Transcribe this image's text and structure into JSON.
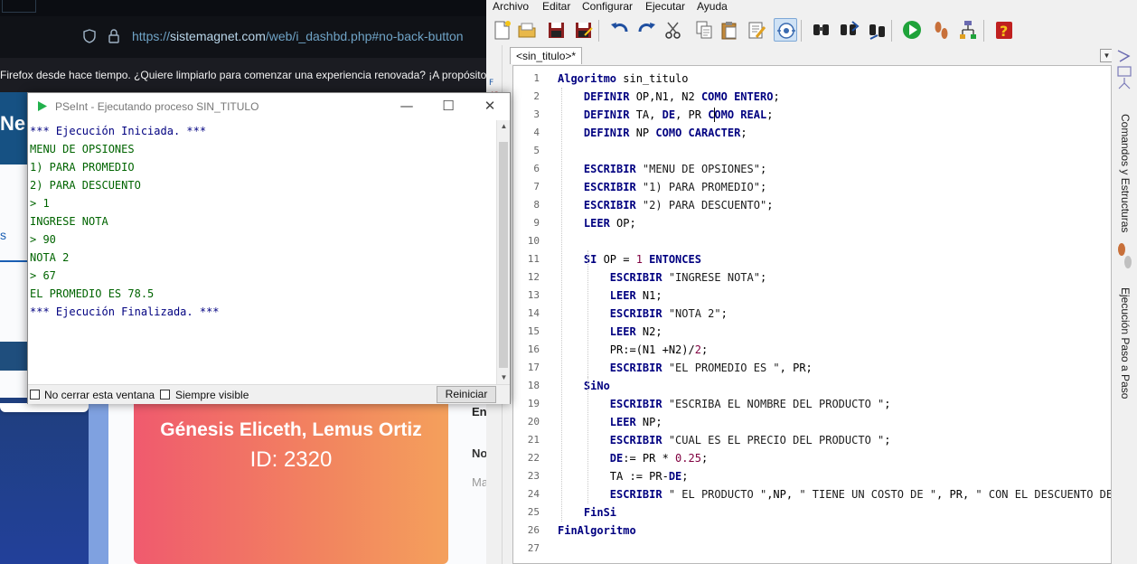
{
  "browser": {
    "url_prefix": "https://",
    "url_domain": "sistemagnet.com",
    "url_path": "/web/i_dashbd.php#no-back-button",
    "notice": "Firefox desde hace tiempo. ¿Quiere limpiarlo para comenzar una experiencia renovada? ¡A propósito, b",
    "page": {
      "heading_partial": "Ne",
      "link_partial": "s",
      "card_name": "Génesis Eliceth, Lemus Ortiz",
      "card_id": "ID: 2320",
      "right_text_1": "En",
      "right_text_2": "No",
      "right_text_3": "Ma"
    }
  },
  "run_window": {
    "title": "PSeInt - Ejecutando proceso SIN_TITULO",
    "controls": {
      "minimize": "—",
      "maximize": "☐",
      "close": "✕"
    },
    "output": [
      {
        "text": "*** Ejecución Iniciada. ***",
        "color": "#000080"
      },
      {
        "text": "MENU DE OPSIONES",
        "color": "#006400"
      },
      {
        "text": "1) PARA PROMEDIO",
        "color": "#006400"
      },
      {
        "text": "2) PARA DESCUENTO",
        "color": "#006400"
      },
      {
        "text": "> 1",
        "color": "#006400"
      },
      {
        "text": "INGRESE NOTA",
        "color": "#006400"
      },
      {
        "text": "> 90",
        "color": "#006400"
      },
      {
        "text": "NOTA 2",
        "color": "#006400"
      },
      {
        "text": "> 67",
        "color": "#006400"
      },
      {
        "text": "EL PROMEDIO ES 78.5",
        "color": "#006400"
      },
      {
        "text": "*** Ejecución Finalizada. ***",
        "color": "#000080"
      }
    ],
    "checkbox_keep_open": "No cerrar esta ventana",
    "checkbox_always_visible": "Siempre visible",
    "restart_button": "Reiniciar"
  },
  "editor": {
    "menu": [
      "Archivo",
      "Editar",
      "Configurar",
      "Ejecutar",
      "Ayuda"
    ],
    "toolbar_icons": [
      "new-file-icon",
      "open-folder-icon",
      "save-icon",
      "save-as-icon",
      "undo-icon",
      "redo-icon",
      "cut-icon",
      "copy-icon",
      "paste-icon",
      "edit-icon",
      "indent-icon",
      "find-icon",
      "find-next-icon",
      "replace-icon",
      "run-icon",
      "step-by-step-icon",
      "flowchart-icon",
      "help-icon"
    ],
    "tab_label": "<sin_titulo>*",
    "right_panel": {
      "commands_label": "Comandos y Estructuras",
      "step_label": "Ejecución Paso a Paso"
    },
    "code_lines": [
      [
        {
          "t": "Algoritmo ",
          "k": "kw"
        },
        {
          "t": "sin_titulo",
          "k": "ident"
        }
      ],
      [
        {
          "t": "    DEFINIR ",
          "k": "kw"
        },
        {
          "t": "OP,N1, N2 ",
          "k": "ident"
        },
        {
          "t": "COMO ENTERO",
          "k": "kw"
        },
        {
          "t": ";",
          "k": "ident"
        }
      ],
      [
        {
          "t": "    DEFINIR ",
          "k": "kw"
        },
        {
          "t": "TA, ",
          "k": "ident"
        },
        {
          "t": "DE",
          "k": "kw"
        },
        {
          "t": ", PR ",
          "k": "ident"
        },
        {
          "t": "COMO REAL",
          "k": "kw"
        },
        {
          "t": ";",
          "k": "ident"
        }
      ],
      [
        {
          "t": "    DEFINIR ",
          "k": "kw"
        },
        {
          "t": "NP ",
          "k": "ident"
        },
        {
          "t": "COMO CARACTER",
          "k": "kw"
        },
        {
          "t": ";",
          "k": "ident"
        }
      ],
      [],
      [
        {
          "t": "    ESCRIBIR ",
          "k": "kw"
        },
        {
          "t": "\"MENU DE OPSIONES\"",
          "k": "str"
        },
        {
          "t": ";",
          "k": "ident"
        }
      ],
      [
        {
          "t": "    ESCRIBIR ",
          "k": "kw"
        },
        {
          "t": "\"1) PARA PROMEDIO\"",
          "k": "str"
        },
        {
          "t": ";",
          "k": "ident"
        }
      ],
      [
        {
          "t": "    ESCRIBIR ",
          "k": "kw"
        },
        {
          "t": "\"2) PARA DESCUENTO\"",
          "k": "str"
        },
        {
          "t": ";",
          "k": "ident"
        }
      ],
      [
        {
          "t": "    LEER ",
          "k": "kw"
        },
        {
          "t": "OP;",
          "k": "ident"
        }
      ],
      [],
      [
        {
          "t": "    SI ",
          "k": "kw"
        },
        {
          "t": "OP = ",
          "k": "ident"
        },
        {
          "t": "1",
          "k": "num-lit"
        },
        {
          "t": " ENTONCES",
          "k": "kw"
        }
      ],
      [
        {
          "t": "        ESCRIBIR ",
          "k": "kw"
        },
        {
          "t": "\"INGRESE NOTA\"",
          "k": "str"
        },
        {
          "t": ";",
          "k": "ident"
        }
      ],
      [
        {
          "t": "        LEER ",
          "k": "kw"
        },
        {
          "t": "N1;",
          "k": "ident"
        }
      ],
      [
        {
          "t": "        ESCRIBIR ",
          "k": "kw"
        },
        {
          "t": "\"NOTA 2\"",
          "k": "str"
        },
        {
          "t": ";",
          "k": "ident"
        }
      ],
      [
        {
          "t": "        LEER ",
          "k": "kw"
        },
        {
          "t": "N2;",
          "k": "ident"
        }
      ],
      [
        {
          "t": "        PR:=(N1 +N2)/",
          "k": "ident"
        },
        {
          "t": "2",
          "k": "num-lit"
        },
        {
          "t": ";",
          "k": "ident"
        }
      ],
      [
        {
          "t": "        ESCRIBIR ",
          "k": "kw"
        },
        {
          "t": "\"EL PROMEDIO ES \"",
          "k": "str"
        },
        {
          "t": ", PR;",
          "k": "ident"
        }
      ],
      [
        {
          "t": "    SiNo",
          "k": "kw"
        }
      ],
      [
        {
          "t": "        ESCRIBIR ",
          "k": "kw"
        },
        {
          "t": "\"ESCRIBA EL NOMBRE DEL PRODUCTO \"",
          "k": "str"
        },
        {
          "t": ";",
          "k": "ident"
        }
      ],
      [
        {
          "t": "        LEER ",
          "k": "kw"
        },
        {
          "t": "NP;",
          "k": "ident"
        }
      ],
      [
        {
          "t": "        ESCRIBIR ",
          "k": "kw"
        },
        {
          "t": "\"CUAL ES EL PRECIO DEL PRODUCTO \"",
          "k": "str"
        },
        {
          "t": ";",
          "k": "ident"
        }
      ],
      [
        {
          "t": "        DE",
          "k": "kw"
        },
        {
          "t": ":= PR * ",
          "k": "ident"
        },
        {
          "t": "0.25",
          "k": "num-lit"
        },
        {
          "t": ";",
          "k": "ident"
        }
      ],
      [
        {
          "t": "        TA := PR-",
          "k": "ident"
        },
        {
          "t": "DE",
          "k": "kw"
        },
        {
          "t": ";",
          "k": "ident"
        }
      ],
      [
        {
          "t": "        ESCRIBIR ",
          "k": "kw"
        },
        {
          "t": "\" EL PRODUCTO \"",
          "k": "str"
        },
        {
          "t": ",NP, ",
          "k": "ident"
        },
        {
          "t": "\" TIENE UN COSTO DE \"",
          "k": "str"
        },
        {
          "t": ", PR, ",
          "k": "ident"
        },
        {
          "t": "\" CON EL DESCUENTO DE",
          "k": "str"
        }
      ],
      [
        {
          "t": "    FinSi",
          "k": "kw"
        }
      ],
      [
        {
          "t": "FinAlgoritmo",
          "k": "kw"
        }
      ],
      []
    ]
  },
  "colors": {
    "keyword": "#000080",
    "number": "#800040",
    "console_green": "#006400",
    "console_blue": "#000080",
    "card_gradient_start": "#f05a6e",
    "card_gradient_end": "#f4a05c",
    "url_color": "#6fa3c6"
  }
}
